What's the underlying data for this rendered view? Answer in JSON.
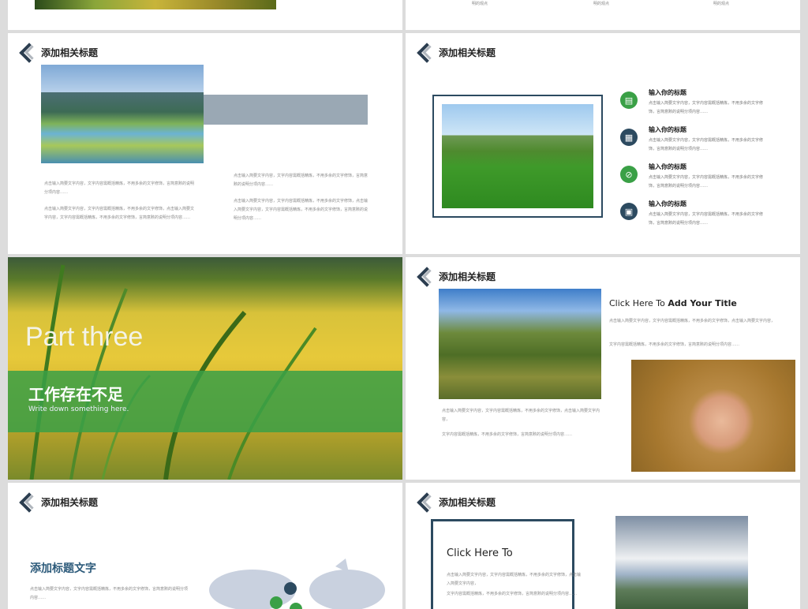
{
  "header_title": "添加相关标题",
  "top_left": {},
  "top_right": {
    "captions": [
      "明的观点",
      "明的观点",
      "明的观点"
    ]
  },
  "slide_a": {
    "para1": "点击输入简要文字内容，文字内容需概括精炼，不用多余的文字修饰，言简意赅的说明分项内容……",
    "para2": "点击输入简要文字内容，文字内容需概括精炼，不用多余的文字修饰，点击输入简要文字内容，文字内容需概括精炼，不用多余的文字修饰，言简意赅的说明分项内容……",
    "para3": "点击输入简要文字内容，文字内容需概括精炼，不用多余的文字修饰，言简意赅的说明分项内容……",
    "para4": "点击输入简要文字内容，文字内容需概括精炼，不用多余的文字修饰，点击输入简要文字内容，文字内容需概括精炼，不用多余的文字修饰，言简意赅的说明分项内容……"
  },
  "slide_b": {
    "items": [
      {
        "title": "输入你的标题",
        "desc": "点击输入简要文字内容，文字内容需概括精炼，不用多余的文字修饰，言简意赅的说明分项内容……",
        "color": "#3aa046",
        "icon": "▤"
      },
      {
        "title": "输入你的标题",
        "desc": "点击输入简要文字内容，文字内容需概括精炼，不用多余的文字修饰，言简意赅的说明分项内容……",
        "color": "#2c4a60",
        "icon": "▦"
      },
      {
        "title": "输入你的标题",
        "desc": "点击输入简要文字内容，文字内容需概括精炼，不用多余的文字修饰，言简意赅的说明分项内容……",
        "color": "#3aa046",
        "icon": "⊘"
      },
      {
        "title": "输入你的标题",
        "desc": "点击输入简要文字内容，文字内容需概括精炼，不用多余的文字修饰，言简意赅的说明分项内容……",
        "color": "#2c4a60",
        "icon": "▣"
      }
    ]
  },
  "slide_c": {
    "part": "Part three",
    "title": "工作存在不足",
    "subtitle": "Write down something here."
  },
  "slide_d": {
    "heading_plain": "Click Here To ",
    "heading_bold": "Add Your Title",
    "para1": "点击输入简要文字内容，文字内容需概括精炼，不用多余的文字修饰，点击输入简要文字内容，",
    "para2": "文字内容需概括精炼，不用多余的文字修饰，言简意赅的说明分项内容……",
    "para3": "点击输入简要文字内容，文字内容需概括精炼，不用多余的文字修饰，点击输入简要文字内容，",
    "para4": "文字内容需概括精炼，不用多余的文字修饰，言简意赅的说明分项内容……"
  },
  "slide_e": {
    "subtitle": "添加标题文字",
    "para1": "点击输入简要文字内容，文字内容需概括精炼，不用多余的文字修饰，言简意赅的说明分项内容……"
  },
  "slide_f": {
    "click_here": "Click Here To",
    "para1": "点击输入简要文字内容，文字内容需概括精炼，不用多余的文字修饰，点击输入简要文字内容，",
    "para2": "文字内容需概括精炼，不用多余的文字修饰，言简意赅的说明分项内容……"
  },
  "colors": {
    "green": "#3aa046",
    "navy": "#2c3e50",
    "slate": "#9aa8b4"
  }
}
